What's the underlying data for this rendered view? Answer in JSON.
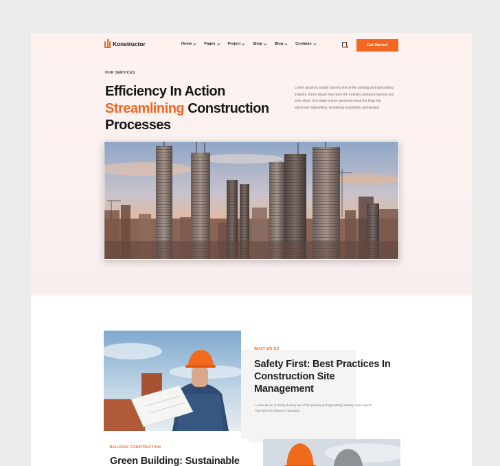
{
  "brand": {
    "name": "Konstructor",
    "accent": "#f26622"
  },
  "nav": {
    "items": [
      {
        "label": "Home"
      },
      {
        "label": "Pages"
      },
      {
        "label": "Project"
      },
      {
        "label": "Shop"
      },
      {
        "label": "Blog"
      },
      {
        "label": "Contacts"
      }
    ],
    "cart_icon": "document-cart-icon",
    "cta_label": "Get Started"
  },
  "hero": {
    "eyebrow": "OUR SERVICES",
    "title_line1": "Efficiency In Action",
    "title_accent": "Streamlining",
    "title_line2_rest": " Construction",
    "title_line3": "Processes",
    "description": "Lorem ipsum is simply dummy text of the printing and typesetting industry. lorem Ipsum has been the industry standard dummy text ever since. it to make a type specimen book.the leap into electronic typesetting, remaining essentially unchanged.",
    "image_icon": "city-skyline-image"
  },
  "services": {
    "feature": {
      "eyebrow": "WHAT WE DO",
      "title": "Safety First: Best Practices In Construction Site Management",
      "description": "Lorem Ipsum is simply dummy text of the printing and typesetting industry. lorem Ipsum has been the industry's standard.",
      "image_icon": "construction-worker-image"
    },
    "second": {
      "eyebrow": "BUILDING CONSTRUCTION",
      "title": "Green Building: Sustainable",
      "image_icon": "workers-helmets-image"
    }
  }
}
